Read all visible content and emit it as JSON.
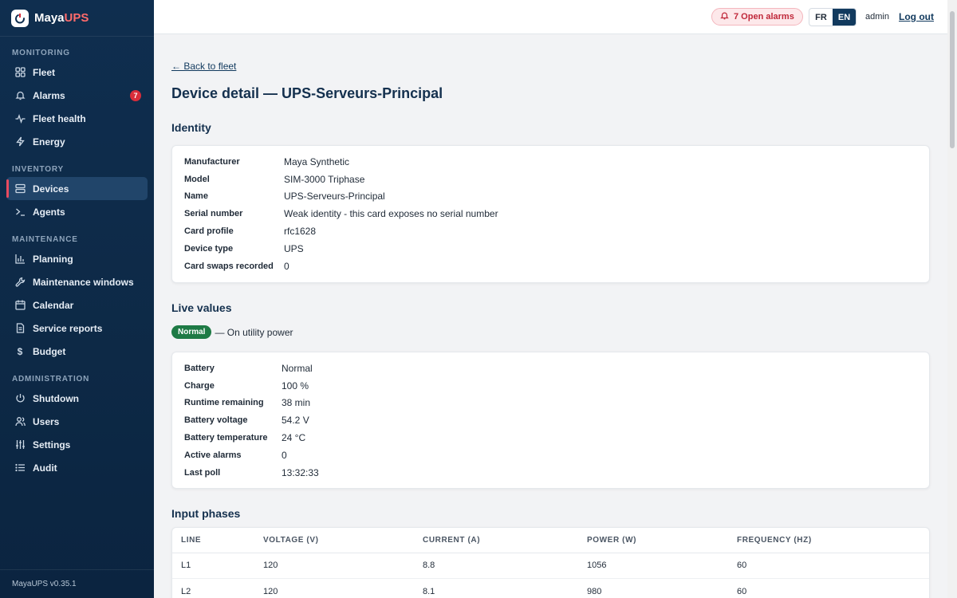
{
  "brand": {
    "name_main": "Maya",
    "name_accent": "UPS"
  },
  "sidebar": {
    "sections": [
      {
        "title": "MONITORING",
        "items": [
          {
            "label": "Fleet",
            "icon": "grid-icon"
          },
          {
            "label": "Alarms",
            "icon": "bell-icon",
            "badge": "7"
          },
          {
            "label": "Fleet health",
            "icon": "pulse-icon"
          },
          {
            "label": "Energy",
            "icon": "lightning-icon"
          }
        ]
      },
      {
        "title": "INVENTORY",
        "items": [
          {
            "label": "Devices",
            "icon": "server-icon",
            "active": true
          },
          {
            "label": "Agents",
            "icon": "terminal-icon"
          }
        ]
      },
      {
        "title": "MAINTENANCE",
        "items": [
          {
            "label": "Planning",
            "icon": "bar-chart-icon"
          },
          {
            "label": "Maintenance windows",
            "icon": "wrench-icon"
          },
          {
            "label": "Calendar",
            "icon": "calendar-icon"
          },
          {
            "label": "Service reports",
            "icon": "document-icon"
          },
          {
            "label": "Budget",
            "icon": "dollar-icon"
          }
        ]
      },
      {
        "title": "ADMINISTRATION",
        "items": [
          {
            "label": "Shutdown",
            "icon": "power-icon"
          },
          {
            "label": "Users",
            "icon": "users-icon"
          },
          {
            "label": "Settings",
            "icon": "sliders-icon"
          },
          {
            "label": "Audit",
            "icon": "list-icon"
          }
        ]
      }
    ],
    "version": "MayaUPS v0.35.1"
  },
  "topbar": {
    "alarm_pill": "7 Open alarms",
    "languages": [
      "FR",
      "EN"
    ],
    "active_language": "EN",
    "user": "admin",
    "logout": "Log out"
  },
  "main": {
    "back_link": "← Back to fleet",
    "title": "Device detail — UPS-Serveurs-Principal",
    "identity": {
      "heading": "Identity",
      "rows": [
        {
          "key": "Manufacturer",
          "value": "Maya Synthetic"
        },
        {
          "key": "Model",
          "value": "SIM-3000 Triphase"
        },
        {
          "key": "Name",
          "value": "UPS-Serveurs-Principal"
        },
        {
          "key": "Serial number",
          "value": "Weak identity - this card exposes no serial number"
        },
        {
          "key": "Card profile",
          "value": "rfc1628"
        },
        {
          "key": "Device type",
          "value": "UPS"
        },
        {
          "key": "Card swaps recorded",
          "value": "0"
        }
      ]
    },
    "live": {
      "heading": "Live values",
      "status_badge": "Normal",
      "status_text": "— On utility power",
      "rows": [
        {
          "key": "Battery",
          "value": "Normal"
        },
        {
          "key": "Charge",
          "value": "100 %"
        },
        {
          "key": "Runtime remaining",
          "value": "38 min"
        },
        {
          "key": "Battery voltage",
          "value": "54.2 V"
        },
        {
          "key": "Battery temperature",
          "value": "24 °C"
        },
        {
          "key": "Active alarms",
          "value": "0"
        },
        {
          "key": "Last poll",
          "value": "13:32:33"
        }
      ]
    },
    "input_phases": {
      "heading": "Input phases",
      "columns": [
        "LINE",
        "VOLTAGE (V)",
        "CURRENT (A)",
        "POWER (W)",
        "FREQUENCY (HZ)"
      ],
      "rows": [
        [
          "L1",
          "120",
          "8.8",
          "1056",
          "60"
        ],
        [
          "L2",
          "120",
          "8.1",
          "980",
          "60"
        ]
      ]
    }
  },
  "colors": {
    "sidebar_bg": "#0f2e4f",
    "accent_red": "#d92d3a",
    "status_green": "#1e7a45",
    "primary": "#123a5e"
  }
}
